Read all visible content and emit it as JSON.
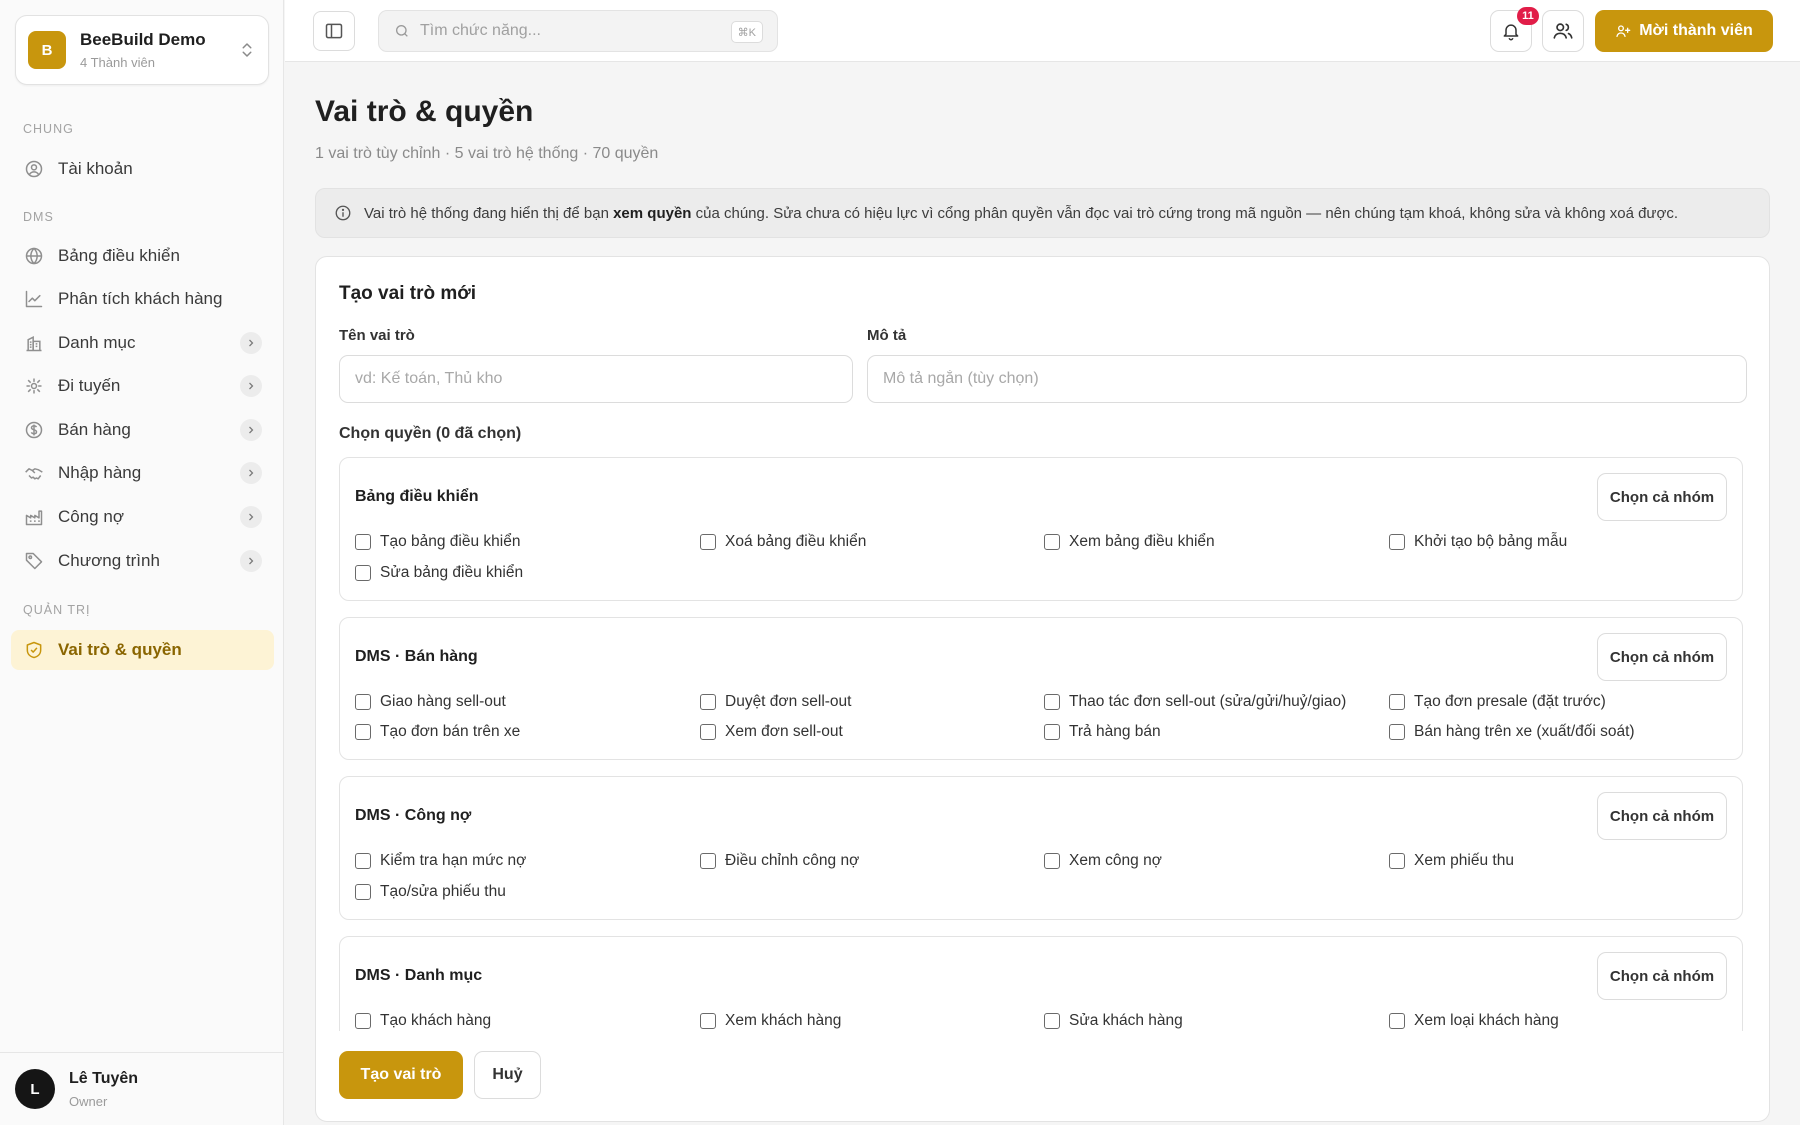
{
  "workspace": {
    "logo_letter": "B",
    "name": "BeeBuild Demo",
    "members": "4 Thành viên"
  },
  "sidebar": {
    "sections": {
      "general": "CHUNG",
      "dms": "DMS",
      "admin": "QUẢN TRỊ"
    },
    "items": [
      {
        "label": "Tài khoản",
        "icon": "user-circle-icon"
      },
      {
        "label": "Bảng điều khiển",
        "icon": "globe-icon"
      },
      {
        "label": "Phân tích khách hàng",
        "icon": "line-chart-icon"
      },
      {
        "label": "Danh mục",
        "icon": "building-icon"
      },
      {
        "label": "Đi tuyến",
        "icon": "route-icon"
      },
      {
        "label": "Bán hàng",
        "icon": "dollar-circle-icon"
      },
      {
        "label": "Nhập hàng",
        "icon": "handshake-icon"
      },
      {
        "label": "Công nợ",
        "icon": "factory-icon"
      },
      {
        "label": "Chương trình",
        "icon": "tag-icon"
      },
      {
        "label": "Vai trò & quyền",
        "icon": "shield-check-icon",
        "active": true
      }
    ]
  },
  "user": {
    "initial": "L",
    "name": "Lê Tuyên",
    "role": "Owner"
  },
  "topbar": {
    "search_placeholder": "Tìm chức năng...",
    "shortcut": "⌘K",
    "notification_count": "11",
    "invite_label": "Mời thành viên"
  },
  "page": {
    "title": "Vai trò & quyền",
    "subtitle": "1 vai trò tùy chỉnh · 5 vai trò hệ thống · 70 quyền",
    "notice_before": "Vai trò hệ thống đang hiển thị để bạn ",
    "notice_bold": "xem quyền",
    "notice_after": " của chúng. Sửa chưa có hiệu lực vì cổng phân quyền vẫn đọc vai trò cứng trong mã nguồn — nên chúng tạm khoá, không sửa và không xoá được."
  },
  "form": {
    "title": "Tạo vai trò mới",
    "name_label": "Tên vai trò",
    "name_placeholder": "vd: Kế toán, Thủ kho",
    "desc_label": "Mô tả",
    "desc_placeholder": "Mô tả ngắn (tùy chọn)",
    "permissions_label": "Chọn quyền (0 đã chọn)",
    "select_group_label": "Chọn cả nhóm",
    "groups": [
      {
        "title": "Bảng điều khiển",
        "permissions": [
          "Tạo bảng điều khiển",
          "Xoá bảng điều khiển",
          "Xem bảng điều khiển",
          "Khởi tạo bộ bảng mẫu",
          "Sửa bảng điều khiển"
        ]
      },
      {
        "title": "DMS · Bán hàng",
        "permissions": [
          "Giao hàng sell-out",
          "Duyệt đơn sell-out",
          "Thao tác đơn sell-out (sửa/gửi/huỷ/giao)",
          "Tạo đơn presale (đặt trước)",
          "Tạo đơn bán trên xe",
          "Xem đơn sell-out",
          "Trả hàng bán",
          "Bán hàng trên xe (xuất/đối soát)"
        ]
      },
      {
        "title": "DMS · Công nợ",
        "permissions": [
          "Kiểm tra hạn mức nợ",
          "Điều chỉnh công nợ",
          "Xem công nợ",
          "Xem phiếu thu",
          "Tạo/sửa phiếu thu"
        ]
      },
      {
        "title": "DMS · Danh mục",
        "permissions": [
          "Tạo khách hàng",
          "Xem khách hàng",
          "Sửa khách hàng",
          "Xem loại khách hàng"
        ]
      }
    ],
    "submit_label": "Tạo vai trò",
    "cancel_label": "Huỷ"
  },
  "colors": {
    "accent": "#c8960d",
    "active_bg": "#fdf3d5",
    "badge": "#e11d48"
  }
}
